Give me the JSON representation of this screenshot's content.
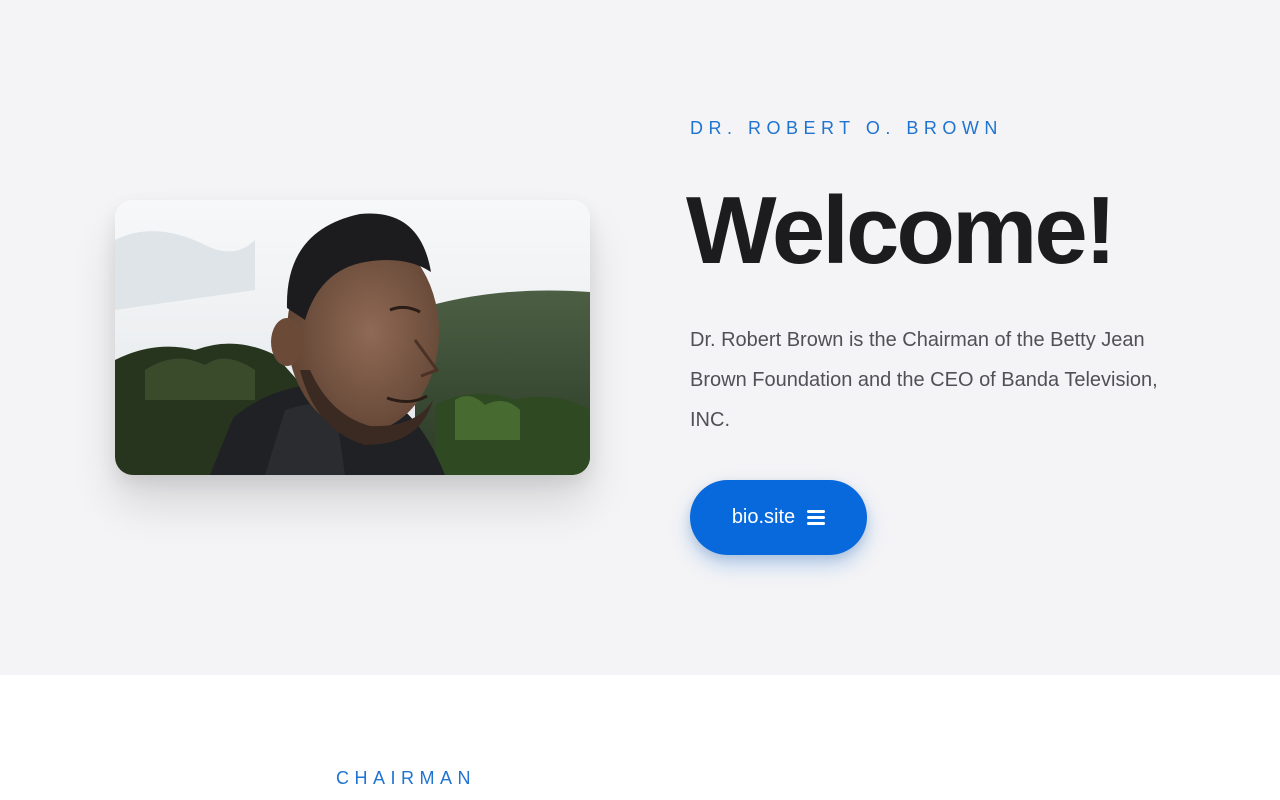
{
  "hero": {
    "eyebrow": "DR. ROBERT O. BROWN",
    "headline": "Welcome!",
    "intro": "Dr. Robert Brown is the Chairman of the Betty Jean Brown Foundation and the CEO of Banda Television, INC.",
    "button_label": "bio.site",
    "button_icon": "menu-icon",
    "photo_alt": "Portrait of Dr. Robert O. Brown outdoors"
  },
  "section_two": {
    "eyebrow": "CHAIRMAN"
  },
  "colors": {
    "accent": "#0769db",
    "eyebrow": "#1f73d1",
    "hero_background": "#f4f4f6",
    "headline": "#1c1c1e",
    "body_text": "#505057"
  }
}
